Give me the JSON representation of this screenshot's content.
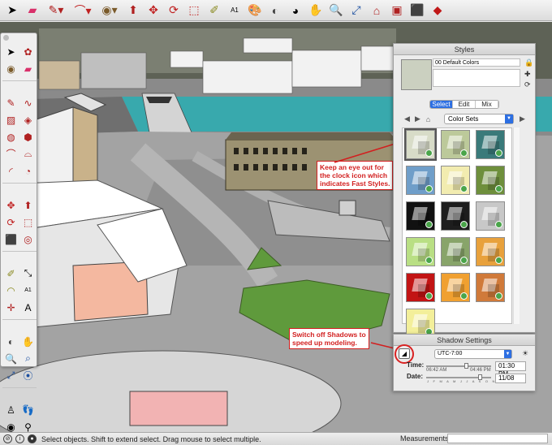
{
  "toolbar": {
    "icons": [
      "select-arrow-icon",
      "eraser-icon",
      "pencil-line-icon",
      "arc-icon",
      "paint-bucket-icon",
      "push-pull-icon",
      "move-icon",
      "rotate-icon",
      "scale-icon",
      "tape-measure-icon",
      "text-icon",
      "paint-icon",
      "color-wheel-icon",
      "orbit-icon",
      "zoom-icon",
      "zoom-extents-icon",
      "warehouse-icon",
      "extension-icon",
      "ruby-icon"
    ],
    "text_tool": "A1"
  },
  "styles_panel": {
    "title": "Styles",
    "style_name": "00 Default Colors",
    "tabs": [
      "Select",
      "Edit",
      "Mix"
    ],
    "active_tab": "Select",
    "collection": "Color Sets",
    "swatch_colors": [
      "#d8dcc8",
      "#bcc99a",
      "#3a7a7a",
      "#6f9ec9",
      "#f2ecb0",
      "#6e8f3c",
      "#111111",
      "#1d1d1d",
      "#c8c8c8",
      "#b9df84",
      "#88a46a",
      "#e8a13c",
      "#c21414",
      "#f0a030",
      "#d07a3a",
      "#f3ef9a"
    ]
  },
  "shadow_panel": {
    "title": "Shadow Settings",
    "timezone": "UTC-7:00",
    "time_label": "Time:",
    "date_label": "Date:",
    "sunrise": "06:42 AM",
    "sunset": "04:46 PM",
    "time_value": "01:30 PM",
    "date_value": "11/08",
    "months": "J F M A M J J A S O N D"
  },
  "callouts": {
    "fast_styles": [
      "Keep an eye out for",
      "the clock icon which",
      "indicates Fast Styles."
    ],
    "shadows": [
      "Switch off Shadows to",
      "speed up modeling."
    ]
  },
  "status": {
    "message": "Select objects. Shift to extend select. Drag mouse to select multiple.",
    "measurements_label": "Measurements",
    "measurements_value": ""
  },
  "colors": {
    "accent": "#2d6fe2",
    "callout": "#d21f1f",
    "water": "#38a9ad",
    "grass": "#5f9a3c",
    "sky": "#ffffff"
  }
}
